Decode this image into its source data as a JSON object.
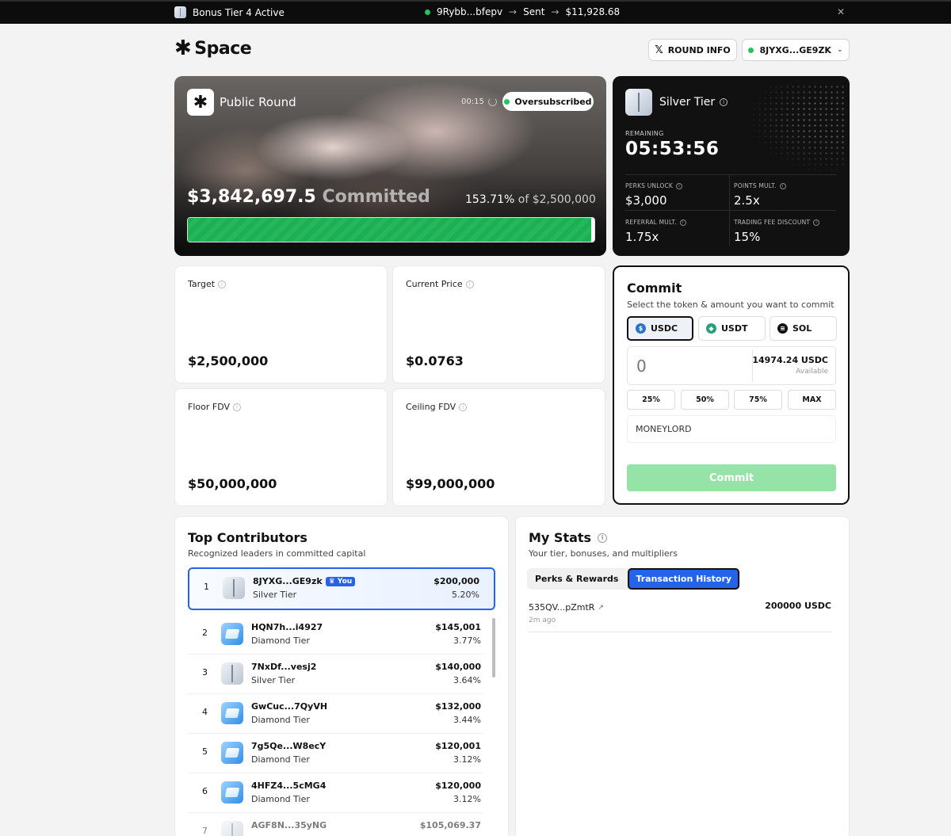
{
  "topbar": {
    "bonus_text": "Bonus Tier 4 Active",
    "wallet": "9Rybb...bfepv",
    "action": "Sent",
    "amount": "$11,928.68",
    "close_icon": "close-icon"
  },
  "header": {
    "logo_text": "Space",
    "round_info_label": "ROUND INFO",
    "wallet_label": "8JYXG...GE9ZK"
  },
  "hero": {
    "title": "Public Round",
    "timer": "00:15",
    "status": "Oversubscribed",
    "committed_amount": "$3,842,697.5",
    "committed_word": "Committed",
    "percent": "153.71%",
    "of_text": "of $2,500,000",
    "progress_fraction": 1.0
  },
  "tier": {
    "name": "Silver Tier",
    "remaining_label": "REMAINING",
    "remaining_value": "05:53:56",
    "perks_unlock_label": "PERKS UNLOCK",
    "perks_unlock_value": "$3,000",
    "points_mult_label": "POINTS MULT.",
    "points_mult_value": "2.5x",
    "referral_mult_label": "REFERRAL MULT.",
    "referral_mult_value": "1.75x",
    "trading_fee_label": "TRADING FEE DISCOUNT",
    "trading_fee_value": "15%"
  },
  "metrics": {
    "target_label": "Target",
    "target_value": "$2,500,000",
    "price_label": "Current Price",
    "price_value": "$0.0763",
    "floor_label": "Floor FDV",
    "floor_value": "$50,000,000",
    "ceiling_label": "Ceiling FDV",
    "ceiling_value": "$99,000,000"
  },
  "commit": {
    "title": "Commit",
    "subtitle": "Select the token & amount you want to commit",
    "tokens": [
      "USDC",
      "USDT",
      "SOL"
    ],
    "selected_token": "USDC",
    "amount_placeholder": "0",
    "balance": "14974.24 USDC",
    "available_label": "Available",
    "presets": [
      "25%",
      "50%",
      "75%",
      "MAX"
    ],
    "referral_value": "MONEYLORD",
    "button_label": "Commit"
  },
  "contributors": {
    "title": "Top Contributors",
    "subtitle": "Recognized leaders in committed capital",
    "you_badge": "You",
    "rows": [
      {
        "rank": "1",
        "name": "8JYXG...GE9zk",
        "tier": "Silver Tier",
        "amount": "$200,000",
        "pct": "5.20%"
      },
      {
        "rank": "2",
        "name": "HQN7h...i4927",
        "tier": "Diamond Tier",
        "amount": "$145,001",
        "pct": "3.77%"
      },
      {
        "rank": "3",
        "name": "7NxDf...vesj2",
        "tier": "Silver Tier",
        "amount": "$140,000",
        "pct": "3.64%"
      },
      {
        "rank": "4",
        "name": "GwCuc...7QyVH",
        "tier": "Diamond Tier",
        "amount": "$132,000",
        "pct": "3.44%"
      },
      {
        "rank": "5",
        "name": "7g5Qe...W8ecY",
        "tier": "Diamond Tier",
        "amount": "$120,001",
        "pct": "3.12%"
      },
      {
        "rank": "6",
        "name": "4HFZ4...5cMG4",
        "tier": "Diamond Tier",
        "amount": "$120,000",
        "pct": "3.12%"
      },
      {
        "rank": "7",
        "name": "AGF8N...35yNG",
        "tier": "",
        "amount": "$105,069.37",
        "pct": ""
      }
    ]
  },
  "stats": {
    "title": "My Stats",
    "subtitle": "Your tier, bonuses, and multipliers",
    "tabs": [
      "Perks & Rewards",
      "Transaction History"
    ],
    "active_tab": "Transaction History",
    "tx": {
      "address": "535QV...pZmtR",
      "time": "2m ago",
      "amount": "200000 USDC"
    }
  },
  "colors": {
    "accent_blue": "#2563eb",
    "success_green": "#22c55e",
    "commit_button": "#96e3a7",
    "dark_card": "#111111"
  }
}
